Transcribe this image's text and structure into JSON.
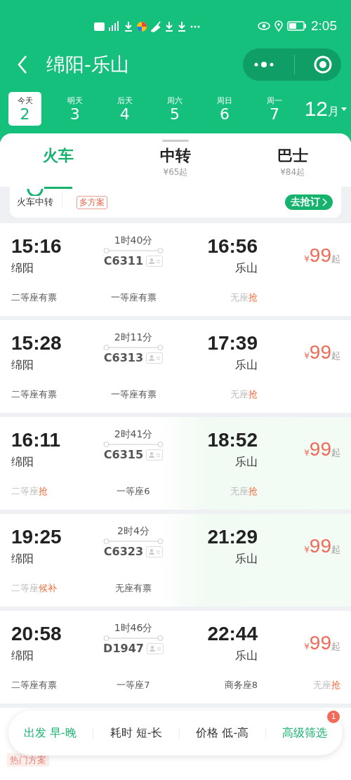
{
  "status_bar": {
    "time": "2:05"
  },
  "header": {
    "title": "绵阳-乐山"
  },
  "dates": [
    {
      "weekday": "今天",
      "day": "2",
      "selected": true
    },
    {
      "weekday": "明天",
      "day": "3",
      "selected": false
    },
    {
      "weekday": "后天",
      "day": "4",
      "selected": false
    },
    {
      "weekday": "周六",
      "day": "5",
      "selected": false
    },
    {
      "weekday": "周日",
      "day": "6",
      "selected": false
    },
    {
      "weekday": "周一",
      "day": "7",
      "selected": false
    }
  ],
  "month": {
    "value": "12",
    "unit": "月"
  },
  "tabs": [
    {
      "label": "火车",
      "selected": true
    },
    {
      "label": "中转",
      "sub": "¥65起",
      "selected": false
    },
    {
      "label": "巴士",
      "sub": "¥84起",
      "selected": false
    }
  ],
  "transfer_card": {
    "label": "火车中转",
    "tag": "多方案",
    "button": "去抢订"
  },
  "trains": [
    {
      "depart_time": "15:16",
      "depart_station": "绵阳",
      "duration": "1时40分",
      "number": "C6311",
      "arrive_time": "16:56",
      "arrive_station": "乐山",
      "currency": "¥",
      "price": "99",
      "price_suffix": "起",
      "highlighted": false,
      "seats": [
        {
          "kind": "available",
          "label": "二等座有票"
        },
        {
          "kind": "available",
          "label": "一等座有票"
        },
        {
          "kind": "grab",
          "label": "无座",
          "action": "抢"
        }
      ]
    },
    {
      "depart_time": "15:28",
      "depart_station": "绵阳",
      "duration": "2时11分",
      "number": "C6313",
      "arrive_time": "17:39",
      "arrive_station": "乐山",
      "currency": "¥",
      "price": "99",
      "price_suffix": "起",
      "highlighted": false,
      "seats": [
        {
          "kind": "available",
          "label": "二等座有票"
        },
        {
          "kind": "available",
          "label": "一等座有票"
        },
        {
          "kind": "grab",
          "label": "无座",
          "action": "抢"
        }
      ]
    },
    {
      "depart_time": "16:11",
      "depart_station": "绵阳",
      "duration": "2时41分",
      "number": "C6315",
      "arrive_time": "18:52",
      "arrive_station": "乐山",
      "currency": "¥",
      "price": "99",
      "price_suffix": "起",
      "highlighted": true,
      "seats": [
        {
          "kind": "grab",
          "label": "二等座",
          "action": "抢"
        },
        {
          "kind": "available",
          "label": "一等座6"
        },
        {
          "kind": "grab",
          "label": "无座",
          "action": "抢"
        }
      ]
    },
    {
      "depart_time": "19:25",
      "depart_station": "绵阳",
      "duration": "2时4分",
      "number": "C6323",
      "arrive_time": "21:29",
      "arrive_station": "乐山",
      "currency": "¥",
      "price": "99",
      "price_suffix": "起",
      "highlighted": true,
      "seats": [
        {
          "kind": "grab",
          "label": "二等座",
          "action": "候补"
        },
        {
          "kind": "available",
          "label": "无座有票"
        }
      ]
    },
    {
      "depart_time": "20:58",
      "depart_station": "绵阳",
      "duration": "1时46分",
      "number": "D1947",
      "arrive_time": "22:44",
      "arrive_station": "乐山",
      "currency": "¥",
      "price": "99",
      "price_suffix": "起",
      "highlighted": false,
      "seats": [
        {
          "kind": "available",
          "label": "二等座有票"
        },
        {
          "kind": "available",
          "label": "一等座7"
        },
        {
          "kind": "available",
          "label": "商务座8"
        },
        {
          "kind": "grab",
          "label": "无座",
          "action": "抢"
        }
      ]
    }
  ],
  "next_card": {
    "tag": "热门方案"
  },
  "filter_bar": {
    "badge": "1",
    "items": [
      {
        "label": "出发 早-晚",
        "selected": true
      },
      {
        "label": "耗时 短-长",
        "selected": false
      },
      {
        "label": "价格 低-高",
        "selected": false
      },
      {
        "label": "高级筛选",
        "selected": true
      }
    ]
  }
}
